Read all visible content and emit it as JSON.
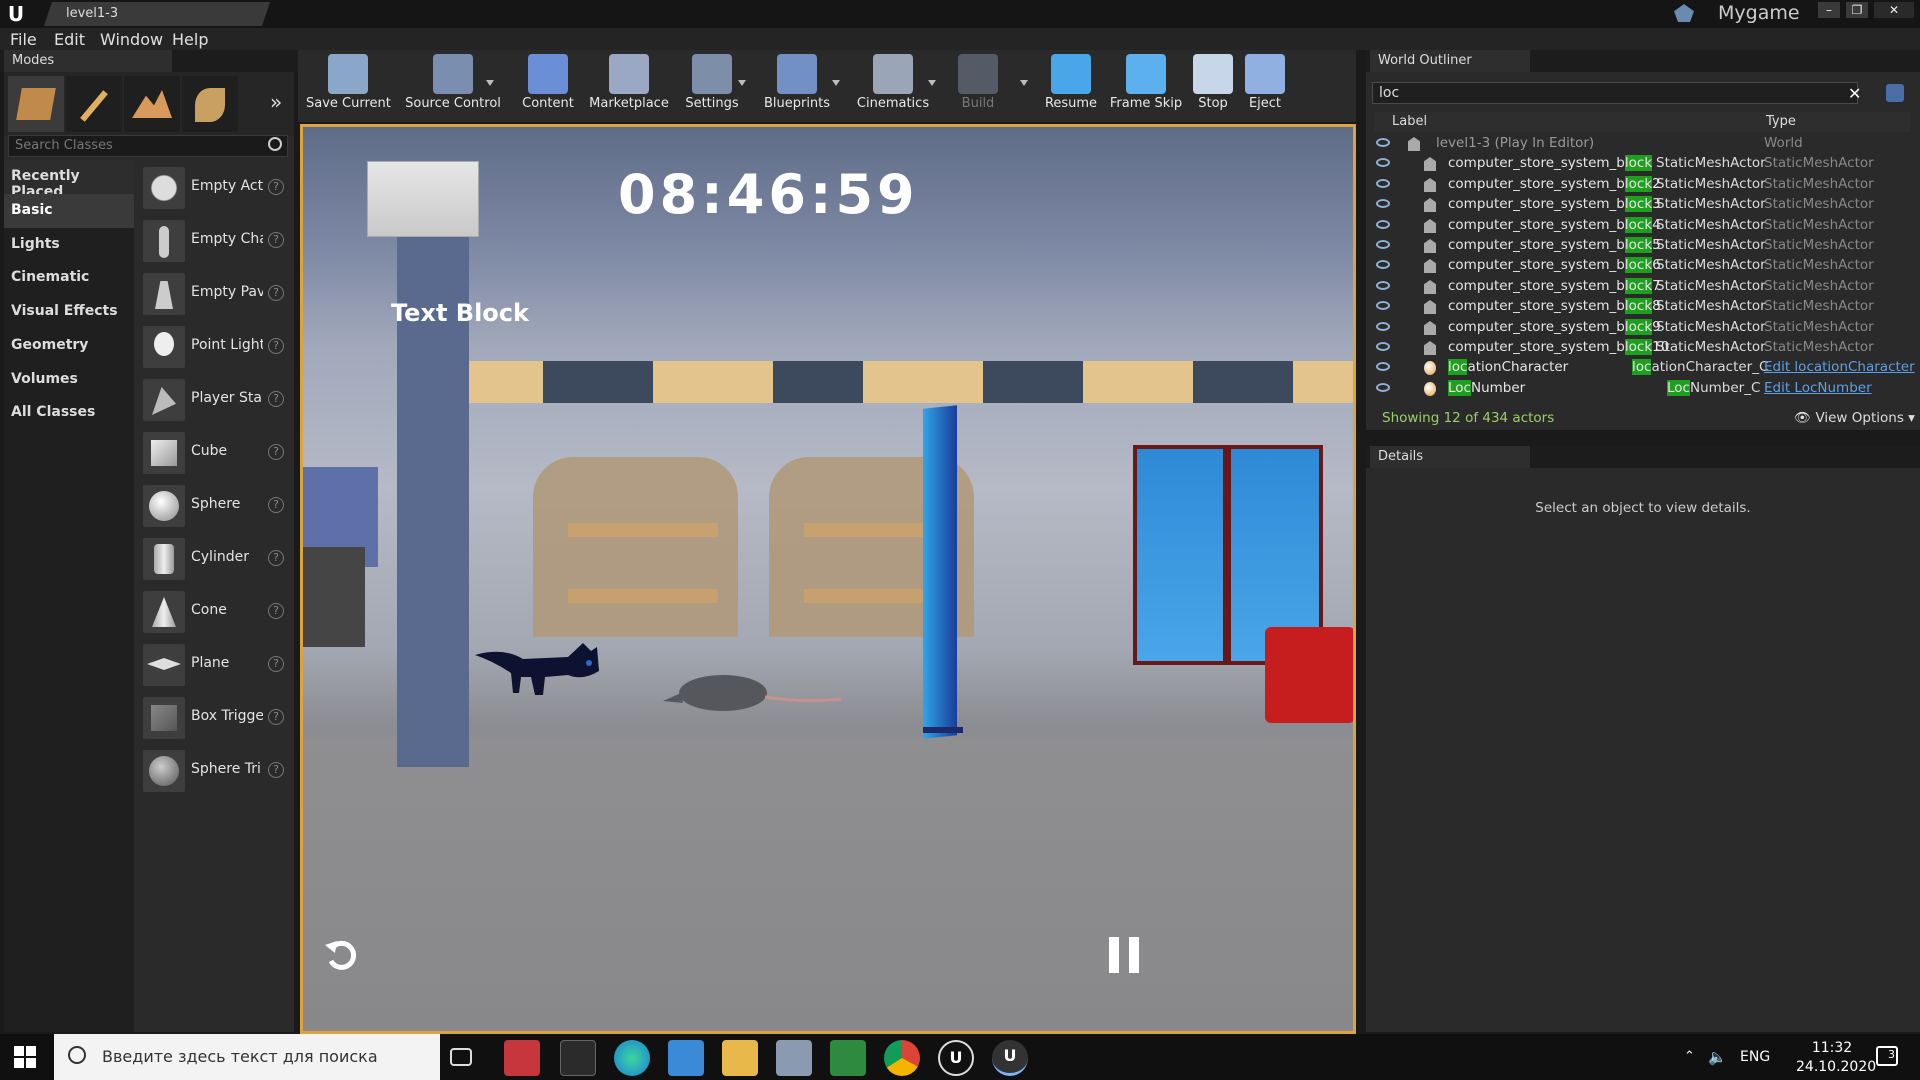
{
  "window": {
    "tab_title": "level1-3",
    "project_name": "Mygame"
  },
  "menu": [
    "File",
    "Edit",
    "Window",
    "Help"
  ],
  "modes": {
    "tab_label": "Modes",
    "search_placeholder": "Search Classes",
    "categories": [
      "Recently Placed",
      "Basic",
      "Lights",
      "Cinematic",
      "Visual Effects",
      "Geometry",
      "Volumes",
      "All Classes"
    ],
    "active_category": "Basic",
    "classes": [
      "Empty Acti",
      "Empty Cha",
      "Empty Pav",
      "Point Light",
      "Player Sta",
      "Cube",
      "Sphere",
      "Cylinder",
      "Cone",
      "Plane",
      "Box Trigge",
      "Sphere Tri"
    ]
  },
  "toolbar": {
    "items": [
      {
        "label": "Save Current",
        "icon": "save-icon",
        "color": "#8aa7c9"
      },
      {
        "label": "Source Control",
        "icon": "source-control-icon",
        "color": "#7a8fb0"
      },
      {
        "label": "Content",
        "icon": "content-icon",
        "color": "#6b8fd6"
      },
      {
        "label": "Marketplace",
        "icon": "marketplace-icon",
        "color": "#9aa8c4"
      },
      {
        "label": "Settings",
        "icon": "settings-icon",
        "color": "#7d8fa8"
      },
      {
        "label": "Blueprints",
        "icon": "blueprints-icon",
        "color": "#7290c4"
      },
      {
        "label": "Cinematics",
        "icon": "cinematics-icon",
        "color": "#9aa6b8"
      },
      {
        "label": "Build",
        "icon": "build-icon",
        "color": "#555b66"
      },
      {
        "label": "Resume",
        "icon": "resume-icon",
        "color": "#4aa6e8"
      },
      {
        "label": "Frame Skip",
        "icon": "frame-skip-icon",
        "color": "#5cb0ee"
      },
      {
        "label": "Stop",
        "icon": "stop-icon",
        "color": "#c8d6ea"
      },
      {
        "label": "Eject",
        "icon": "eject-icon",
        "color": "#8fb0e0"
      }
    ]
  },
  "viewport": {
    "clock": "08:46:59",
    "text_block": "Text Block"
  },
  "outliner": {
    "tab_label": "World Outliner",
    "search_value": "loc",
    "col_label": "Label",
    "col_type": "Type",
    "world_row": {
      "label": "level1-3 (Play In Editor)",
      "type": "World"
    },
    "rows": [
      {
        "pre": "computer_store_system_b",
        "hl": "lock",
        "post": "",
        "type": "StaticMeshActor",
        "type2": "StaticMeshActor"
      },
      {
        "pre": "computer_store_system_b",
        "hl": "lock",
        "post": "2",
        "type": "StaticMeshActor",
        "type2": "StaticMeshActor"
      },
      {
        "pre": "computer_store_system_b",
        "hl": "lock",
        "post": "3",
        "type": "StaticMeshActor",
        "type2": "StaticMeshActor"
      },
      {
        "pre": "computer_store_system_b",
        "hl": "lock",
        "post": "4",
        "type": "StaticMeshActor",
        "type2": "StaticMeshActor"
      },
      {
        "pre": "computer_store_system_b",
        "hl": "lock",
        "post": "5",
        "type": "StaticMeshActor",
        "type2": "StaticMeshActor"
      },
      {
        "pre": "computer_store_system_b",
        "hl": "lock",
        "post": "6",
        "type": "StaticMeshActor",
        "type2": "StaticMeshActor"
      },
      {
        "pre": "computer_store_system_b",
        "hl": "lock",
        "post": "7",
        "type": "StaticMeshActor",
        "type2": "StaticMeshActor"
      },
      {
        "pre": "computer_store_system_b",
        "hl": "lock",
        "post": "8",
        "type": "StaticMeshActor",
        "type2": "StaticMeshActor"
      },
      {
        "pre": "computer_store_system_b",
        "hl": "lock",
        "post": "9",
        "type": "StaticMeshActor",
        "type2": "StaticMeshActor"
      },
      {
        "pre": "computer_store_system_b",
        "hl": "lock",
        "post": "10",
        "type": "StaticMeshActor",
        "type2": "StaticMeshActor"
      }
    ],
    "bp_rows": [
      {
        "hl": "loc",
        "post": "ationCharacter",
        "type_hl": "loc",
        "type_post": "ationCharacter_C",
        "link": "Edit locationCharacter"
      },
      {
        "hl": "Loc",
        "post": "Number",
        "type_hl": "Loc",
        "type_post": "Number_C",
        "link": "Edit LocNumber"
      }
    ],
    "status": "Showing 12 of 434 actors",
    "view_options": "View Options"
  },
  "details": {
    "tab_label": "Details",
    "message": "Select an object to view details."
  },
  "taskbar": {
    "search_placeholder": "Введите здесь текст для поиска",
    "language": "ENG",
    "time": "11:32",
    "date": "24.10.2020",
    "notifications": "3"
  }
}
